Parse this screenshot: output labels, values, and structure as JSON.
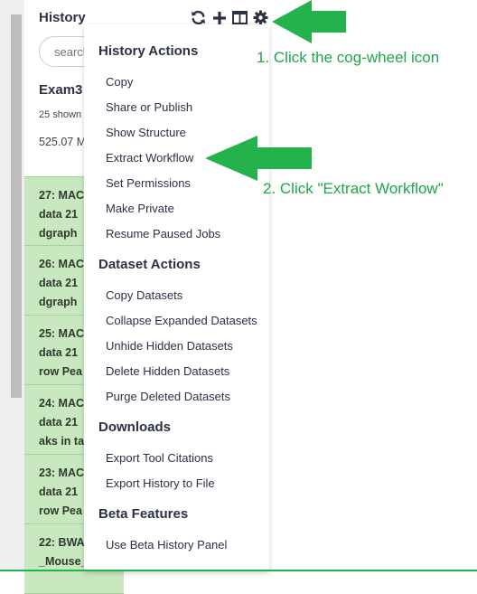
{
  "panel": {
    "title": "History",
    "search_placeholder": "search",
    "history_name": "Exam3",
    "shown_count": "25 shown",
    "size": "525.07 M"
  },
  "datasets": [
    {
      "lines": [
        "27: MAC",
        "data 21",
        "dgraph"
      ]
    },
    {
      "lines": [
        "26: MAC",
        "data 21",
        "dgraph"
      ]
    },
    {
      "lines": [
        "25: MAC",
        "data 21",
        "row Pea"
      ]
    },
    {
      "lines": [
        "24: MAC",
        "data 21",
        "aks in ta"
      ]
    },
    {
      "lines": [
        "23: MAC",
        "data 21",
        "row Pea"
      ]
    },
    {
      "lines": [
        "22: BWA",
        "_Mouse_"
      ]
    }
  ],
  "toolbar": {
    "icons": [
      "refresh-icon",
      "plus-icon",
      "columns-icon",
      "gear-icon"
    ]
  },
  "menu": {
    "history_actions_header": "History Actions",
    "history_actions": [
      "Copy",
      "Share or Publish",
      "Show Structure",
      "Extract Workflow",
      "Set Permissions",
      "Make Private",
      "Resume Paused Jobs"
    ],
    "dataset_actions_header": "Dataset Actions",
    "dataset_actions": [
      "Copy Datasets",
      "Collapse Expanded Datasets",
      "Unhide Hidden Datasets",
      "Delete Hidden Datasets",
      "Purge Deleted Datasets"
    ],
    "downloads_header": "Downloads",
    "downloads": [
      "Export Tool Citations",
      "Export History to File"
    ],
    "beta_header": "Beta Features",
    "beta": [
      "Use Beta History Panel"
    ]
  },
  "annotations": {
    "step1": "1. Click the cog-wheel icon",
    "step2": "2. Click \"Extract Workflow\""
  },
  "colors": {
    "accent_green": "#23b24b",
    "dataset_ok_bg": "#c8e8c0",
    "text_dark": "#2c3143"
  }
}
